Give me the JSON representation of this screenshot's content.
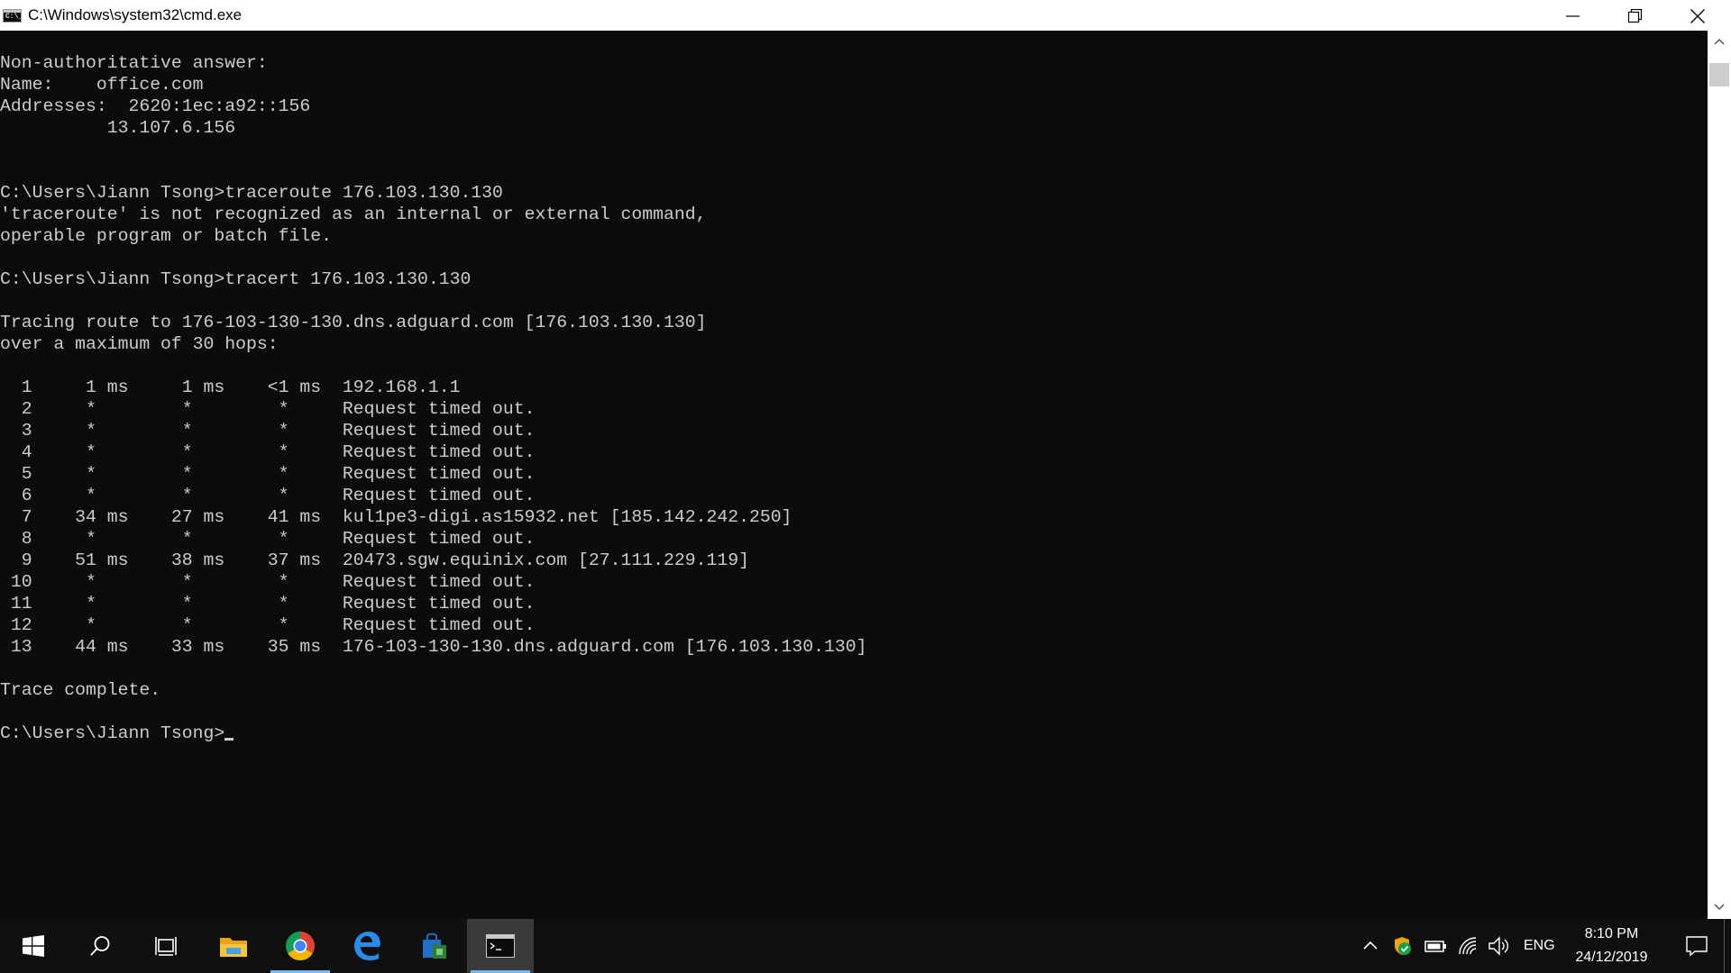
{
  "window": {
    "title": "C:\\Windows\\system32\\cmd.exe",
    "app_icon_glyph": "C:\\_",
    "controls": [
      "minimize-icon",
      "restore-icon",
      "close-icon"
    ]
  },
  "console": {
    "text": "Non-authoritative answer:\nName:    office.com\nAddresses:  2620:1ec:a92::156\n          13.107.6.156\n\n\nC:\\Users\\Jiann Tsong>traceroute 176.103.130.130\n'traceroute' is not recognized as an internal or external command,\noperable program or batch file.\n\nC:\\Users\\Jiann Tsong>tracert 176.103.130.130\n\nTracing route to 176-103-130-130.dns.adguard.com [176.103.130.130]\nover a maximum of 30 hops:\n\n  1     1 ms     1 ms    <1 ms  192.168.1.1\n  2     *        *        *     Request timed out.\n  3     *        *        *     Request timed out.\n  4     *        *        *     Request timed out.\n  5     *        *        *     Request timed out.\n  6     *        *        *     Request timed out.\n  7    34 ms    27 ms    41 ms  kul1pe3-digi.as15932.net [185.142.242.250]\n  8     *        *        *     Request timed out.\n  9    51 ms    38 ms    37 ms  20473.sgw.equinix.com [27.111.229.119]\n 10     *        *        *     Request timed out.\n 11     *        *        *     Request timed out.\n 12     *        *        *     Request timed out.\n 13    44 ms    33 ms    35 ms  176-103-130-130.dns.adguard.com [176.103.130.130]\n\nTrace complete.\n\n",
    "prompt": "C:\\Users\\Jiann Tsong>",
    "colors": {
      "background": "#0c0c0c",
      "foreground": "#cccccc"
    }
  },
  "taskbar": {
    "pinned": [
      "windows-start-icon",
      "search-icon",
      "task-view-icon",
      "file-explorer-icon",
      "chrome-icon",
      "edge-icon",
      "store-icon",
      "command-prompt-icon"
    ],
    "active_app": "command-prompt-icon",
    "tray": {
      "icons": [
        "chevron-up-icon",
        "security-shield-icon",
        "battery-icon",
        "wifi-icon",
        "volume-icon"
      ],
      "language": "ENG",
      "time": "8:10 PM",
      "date": "24/12/2019"
    },
    "accent_color": "#76b9ed"
  }
}
